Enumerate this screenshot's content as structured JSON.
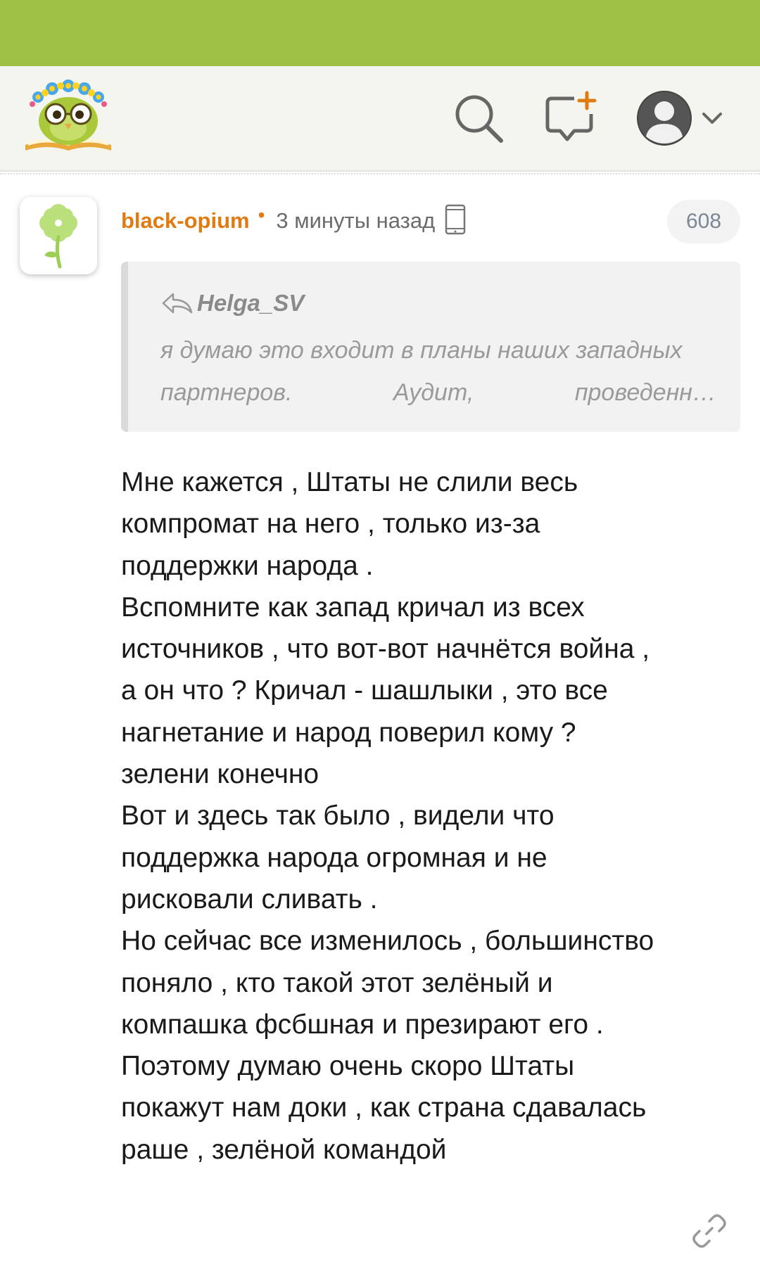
{
  "colors": {
    "status_bar": "#9dc045",
    "header_bg": "#f5f5f0",
    "author": "#e07b12",
    "quote_bg": "#f2f2f2",
    "rating_text": "#7b8794"
  },
  "header": {
    "logo": "owl-with-flower-wreath-on-book",
    "icons": [
      "search-icon",
      "new-comment-icon",
      "user-avatar-icon",
      "chevron-down-icon"
    ]
  },
  "comment": {
    "avatar": "green-clover-flower",
    "author": "black-opium",
    "separator": "•",
    "time": "3 минуты назад",
    "device": "mobile-phone-icon",
    "rating": "608",
    "quote": {
      "author": "Helga_SV",
      "line1": "я думаю это входит в планы наших западных",
      "line2_words": [
        "партнеров.",
        "Аудит,",
        "проведенн…"
      ]
    },
    "lines": [
      "Мне кажется , Штаты не слили весь",
      "компромат на него , только из-за",
      "поддержки народа .",
      "Вспомните как запад кричал из всех",
      "источников , что вот-вот начнётся война ,",
      "а он что ? Кричал - шашлыки , это все",
      "нагнетание и народ поверил кому ?",
      "зелени конечно",
      "Вот и здесь так было , видели что",
      "поддержка народа огромная и не",
      "рисковали сливать .",
      "Но сейчас все изменилось , большинство",
      "поняло , кто такой этот зелёный и",
      "компашка фсбшная и презирают его .",
      "Поэтому думаю очень скоро Штаты",
      "покажут нам доки , как страна сдавалась",
      "раше , зелёной командой"
    ],
    "link_icon": "link-icon"
  }
}
